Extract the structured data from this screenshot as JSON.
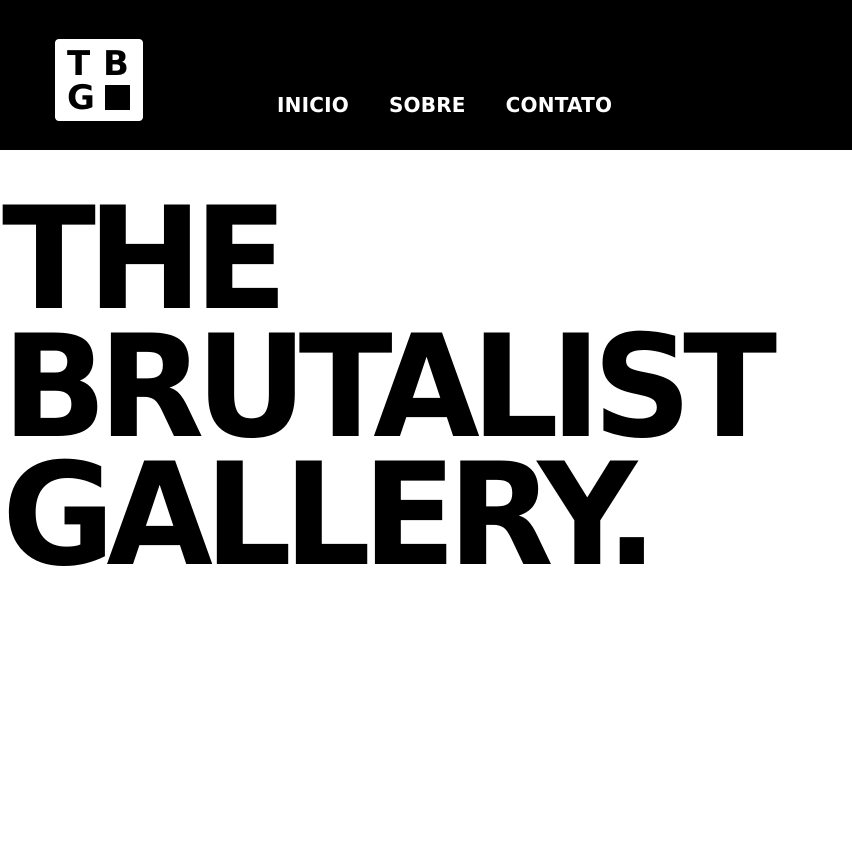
{
  "logo": {
    "letters": [
      "T",
      "B",
      "G"
    ]
  },
  "nav": {
    "items": [
      {
        "label": "INICIO"
      },
      {
        "label": "SOBRE"
      },
      {
        "label": "CONTATO"
      }
    ]
  },
  "hero": {
    "lines": [
      "THE",
      "BRUTALIST",
      "GALLERY."
    ]
  },
  "colors": {
    "header_bg": "#000000",
    "page_bg": "#ffffff",
    "text_primary": "#000000",
    "nav_text": "#ffffff"
  }
}
